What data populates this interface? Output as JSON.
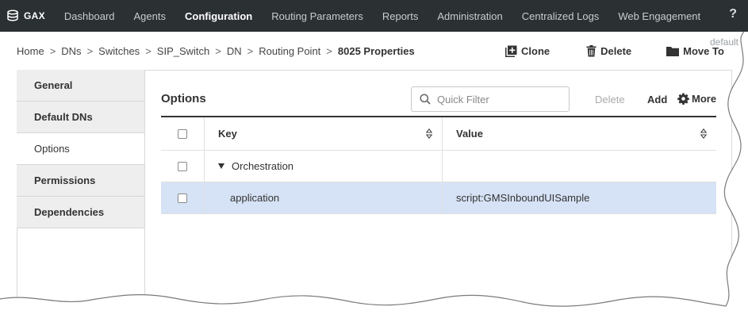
{
  "app": {
    "brand": "GAX",
    "nav": [
      {
        "label": "Dashboard",
        "active": false
      },
      {
        "label": "Agents",
        "active": false
      },
      {
        "label": "Configuration",
        "active": true
      },
      {
        "label": "Routing Parameters",
        "active": false
      },
      {
        "label": "Reports",
        "active": false
      },
      {
        "label": "Administration",
        "active": false
      },
      {
        "label": "Centralized Logs",
        "active": false
      },
      {
        "label": "Web Engagement",
        "active": false
      }
    ],
    "help": "?",
    "tenant": "default"
  },
  "breadcrumb": {
    "items": [
      "Home",
      "DNs",
      "Switches",
      "SIP_Switch",
      "DN",
      "Routing Point"
    ],
    "separator": ">",
    "current": "8025 Properties"
  },
  "toolbar": {
    "clone": "Clone",
    "delete": "Delete",
    "move_to": "Move To"
  },
  "sidebar": {
    "items": [
      {
        "label": "General",
        "active": false
      },
      {
        "label": "Default DNs",
        "active": false
      },
      {
        "label": "Options",
        "active": true
      },
      {
        "label": "Permissions",
        "active": false
      },
      {
        "label": "Dependencies",
        "active": false
      }
    ]
  },
  "content": {
    "title": "Options",
    "filter_placeholder": "Quick Filter",
    "delete": "Delete",
    "add": "Add",
    "more": "More"
  },
  "table": {
    "columns": [
      "Key",
      "Value"
    ],
    "rows": [
      {
        "key": "Orchestration",
        "value": "",
        "group": true,
        "selected": false
      },
      {
        "key": "application",
        "value": "script:GMSInboundUISample",
        "group": false,
        "selected": true
      }
    ]
  },
  "icons": {
    "brand": "database-icon",
    "clone": "add-box-icon",
    "delete": "trash-icon",
    "move_to": "folder-icon",
    "search": "search-icon",
    "more": "gear-icon",
    "sort": "sort-icon",
    "expand": "triangle-down-icon",
    "collapse": "chevron-left-icon"
  },
  "colors": {
    "nav_bg": "#2b3033",
    "selected_row": "#d6e2f5",
    "sidebar_bg": "#eeeeee"
  }
}
